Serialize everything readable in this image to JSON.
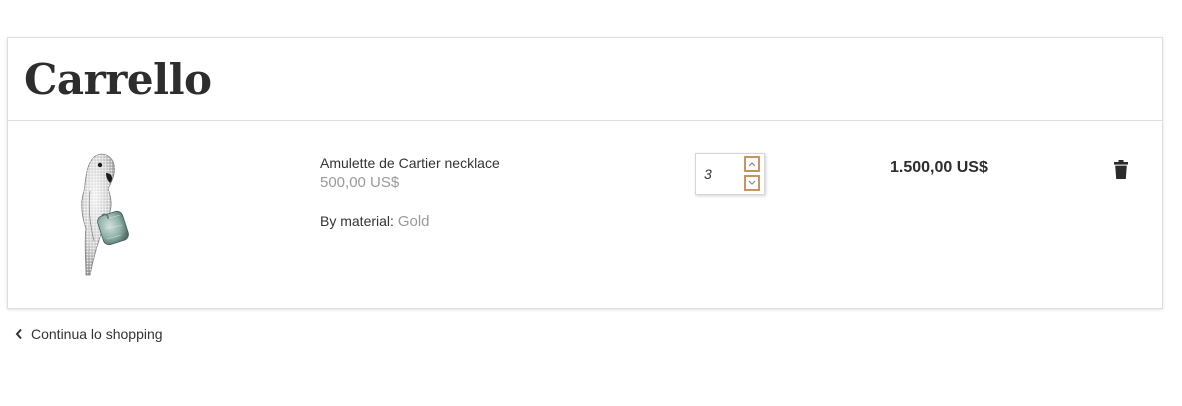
{
  "cart": {
    "title": "Carrello"
  },
  "item": {
    "name": "Amulette de Cartier necklace",
    "unit_price": "500,00 US$",
    "attribute_label": "By material:",
    "attribute_value": "Gold",
    "quantity": "3",
    "line_total": "1.500,00 US$"
  },
  "icons": {
    "product_image": "parrot-brooch-image",
    "increment": "chevron-up-icon",
    "decrement": "chevron-down-icon",
    "delete": "trash-icon",
    "back": "chevron-left-icon"
  },
  "colors": {
    "stepper_accent": "#c9955f",
    "price_muted": "#9a9a9a"
  },
  "footer": {
    "continue_label": "Continua lo shopping"
  }
}
